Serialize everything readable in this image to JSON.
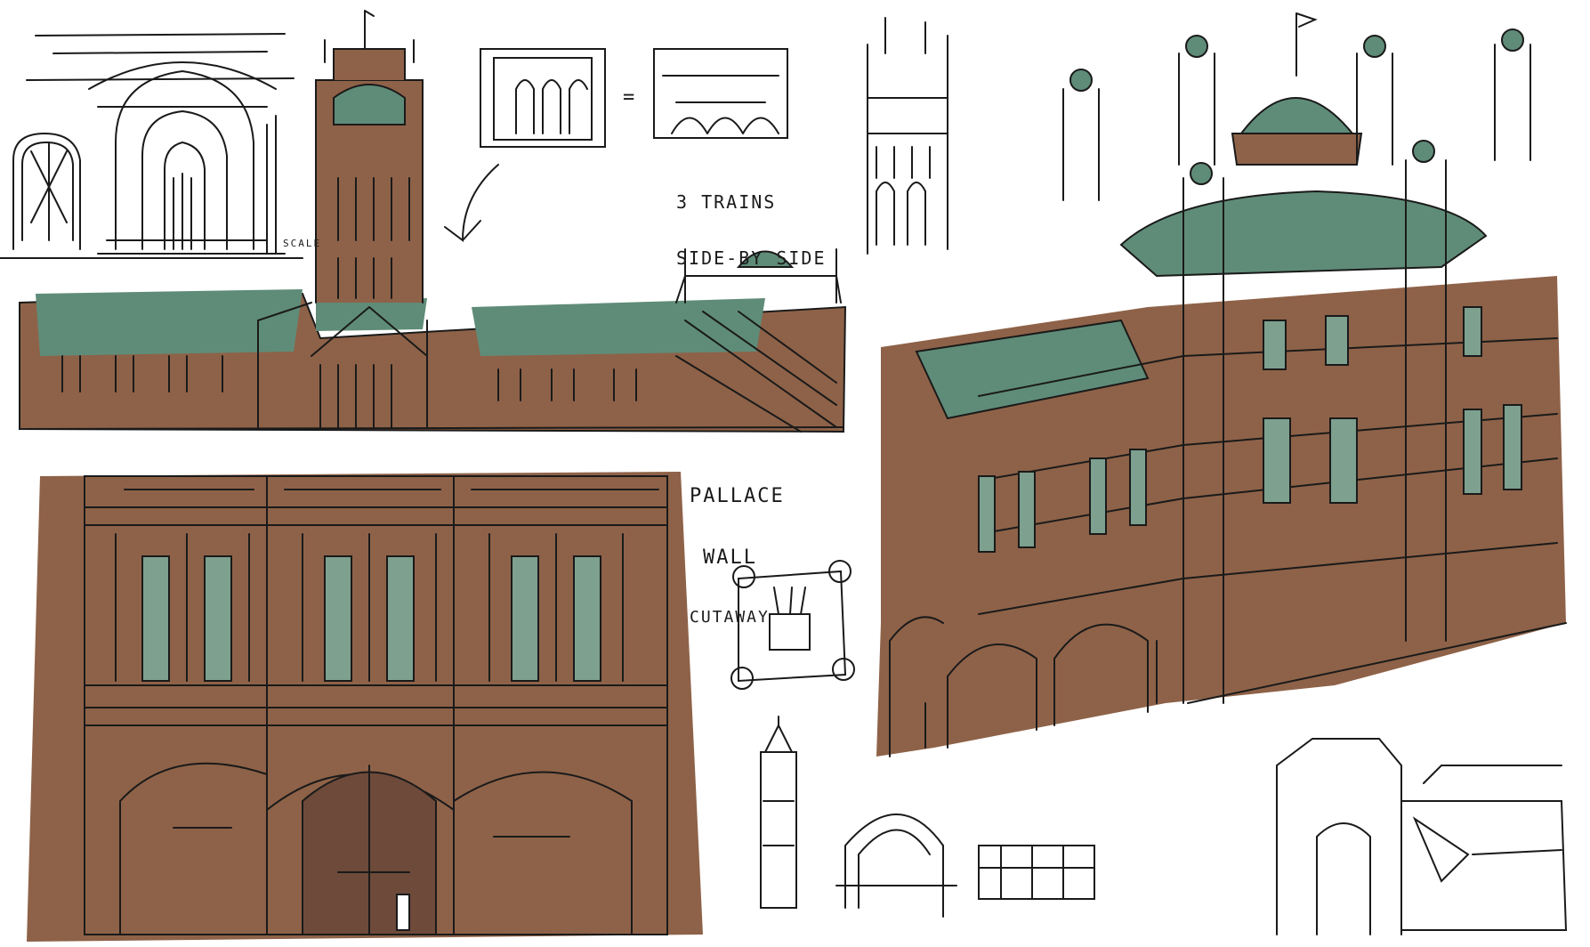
{
  "annotations": {
    "trains_line1": "3 TRAINS",
    "trains_line2": "SIDE-BY SIDE",
    "equals": "=",
    "palace_line1": "PALLACE",
    "palace_line2": "WALL",
    "palace_line3": "CUTAWAY",
    "scale": "SCALE"
  },
  "colors": {
    "brick": "#8e6248",
    "brick_dark": "#6e4a3a",
    "roof_green": "#5f8c78",
    "window_green": "#7da08f",
    "ink": "#1a1a1a",
    "paper": "#ffffff"
  }
}
